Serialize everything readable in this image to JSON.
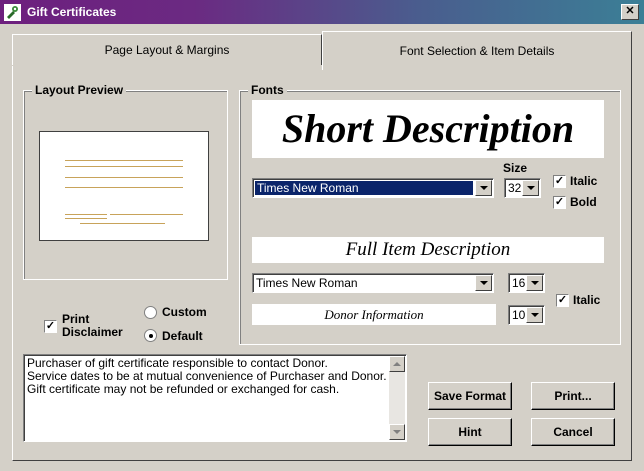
{
  "window": {
    "title": "Gift Certificates",
    "close_label": "✕"
  },
  "tabs": [
    {
      "label": "Page Layout & Margins",
      "active": false
    },
    {
      "label": "Font Selection & Item Details",
      "active": true
    }
  ],
  "layout_preview": {
    "label": "Layout Preview"
  },
  "fonts": {
    "label": "Fonts",
    "short_description": {
      "sample": "Short Description",
      "font": "Times New Roman",
      "size": "32",
      "size_label": "Size",
      "italic_label": "Italic",
      "italic": true,
      "bold_label": "Bold",
      "bold": true
    },
    "full_description": {
      "sample": "Full Item Description",
      "font": "Times New Roman",
      "size": "16",
      "italic_label": "Italic",
      "italic": true
    },
    "donor": {
      "sample": "Donor Information",
      "size": "10"
    }
  },
  "disclaimer": {
    "print_label": "Print Disclaimer",
    "print_checked": true,
    "custom_label": "Custom",
    "default_label": "Default",
    "selected": "Default",
    "text": "Purchaser of gift certificate responsible to contact Donor.\nService dates to be at mutual convenience of Purchaser and Donor.\nGift certificate may not be refunded or exchanged for cash."
  },
  "buttons": {
    "save_format": "Save Format",
    "print": "Print...",
    "hint": "Hint",
    "cancel": "Cancel"
  },
  "check_mark": "✓",
  "colors": {
    "titlebar_start": "#6d1f7e",
    "titlebar_end": "#3b7f96",
    "selection": "#0a246a",
    "preview_lines": "#c8a35a",
    "face": "#d4d0c8"
  }
}
